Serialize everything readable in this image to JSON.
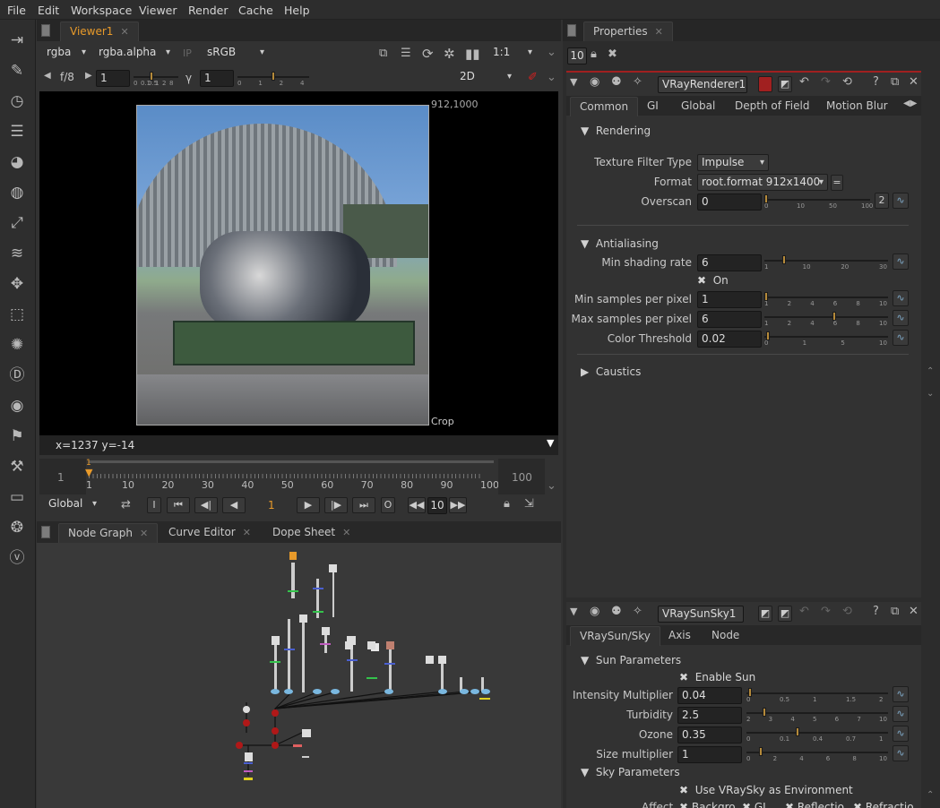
{
  "menu": [
    "File",
    "Edit",
    "Workspace",
    "Viewer",
    "Render",
    "Cache",
    "Help"
  ],
  "toolbar_icons": [
    "hide-panel-icon",
    "paint-icon",
    "clock-icon",
    "channel-icon",
    "color-icon",
    "filter-icon",
    "keyer-icon",
    "merge-icon",
    "transform-icon",
    "3d-icon",
    "particles-icon",
    "deep-icon",
    "views-icon",
    "metadata-icon",
    "toolsets-icon",
    "other-icon",
    "furnace-icon",
    "vray-icon"
  ],
  "viewer": {
    "tab": "Viewer1",
    "channels": "rgba",
    "alpha": "rgba.alpha",
    "ip": "IP",
    "colorspace": "sRGB",
    "zoom": "1:1",
    "fstop": "f/8",
    "gain": "1",
    "gamma_label": "γ",
    "gamma": "1",
    "gain_ticks": [
      "0",
      "0.1",
      "0.5",
      "1",
      "2",
      "8"
    ],
    "gamma_ticks": [
      "0",
      "1",
      "2",
      "4"
    ],
    "view_mode": "2D",
    "res_label": "912,1000",
    "crop_label": "Crop",
    "coords": "x=1237 y=-14",
    "timeline_start": "1",
    "timeline_end": "100",
    "timeline_ticks": [
      "1",
      "10",
      "20",
      "30",
      "40",
      "50",
      "60",
      "70",
      "80",
      "90",
      "100"
    ],
    "current_frame_marker": "1",
    "global": "Global",
    "frame": "1",
    "step": "10",
    "in_btn": "I",
    "out_btn": "O",
    "image_desc": "photo of a jet turbine engine on a green stand in front of a metal hangar"
  },
  "nodegraph": {
    "tabs": [
      "Node Graph",
      "Curve Editor",
      "Dope Sheet"
    ]
  },
  "properties": {
    "tab": "Properties",
    "count": "10",
    "renderer": {
      "name": "VRayRenderer1",
      "tabs": [
        "Common",
        "GI",
        "Global",
        "Depth of Field",
        "Motion Blur"
      ],
      "sections": {
        "rendering": "Rendering",
        "antialiasing": "Antialiasing",
        "caustics": "Caustics"
      },
      "texture_filter_label": "Texture Filter Type",
      "texture_filter": "Impulse",
      "format_label": "Format",
      "format": "root.format 912x1400",
      "format_eq": "=",
      "overscan_label": "Overscan",
      "overscan": "0",
      "overscan_ticks": [
        "0",
        "10",
        "50",
        "100"
      ],
      "overscan_btn": "2",
      "min_shading_label": "Min shading rate",
      "min_shading": "6",
      "min_shading_ticks": [
        "1",
        "10",
        "20",
        "30"
      ],
      "on_label": "On",
      "min_samples_label": "Min samples per pixel",
      "min_samples": "1",
      "max_samples_label": "Max samples per pixel",
      "max_samples": "6",
      "samples_ticks": [
        "1",
        "2",
        "4",
        "6",
        "8",
        "10"
      ],
      "color_threshold_label": "Color Threshold",
      "color_threshold": "0.02",
      "threshold_ticks": [
        "0",
        "1",
        "5",
        "10"
      ]
    },
    "sunsky": {
      "name": "VRaySunSky1",
      "tabs": [
        "VRaySun/Sky",
        "Axis",
        "Node"
      ],
      "sun_section": "Sun Parameters",
      "enable_sun": "Enable Sun",
      "intensity_label": "Intensity Multiplier",
      "intensity": "0.04",
      "intensity_ticks": [
        "0",
        "0.5",
        "1",
        "1.5",
        "2"
      ],
      "turbidity_label": "Turbidity",
      "turbidity": "2.5",
      "turbidity_ticks": [
        "2",
        "3",
        "4",
        "5",
        "6",
        "7",
        "10"
      ],
      "ozone_label": "Ozone",
      "ozone": "0.35",
      "ozone_ticks": [
        "0",
        "0.1",
        "0.4",
        "0.7",
        "1"
      ],
      "size_label": "Size multiplier",
      "size": "1",
      "size_ticks": [
        "0",
        "2",
        "4",
        "6",
        "8",
        "10"
      ],
      "sky_section": "Sky Parameters",
      "use_vraysky": "Use VRaySky as Environment",
      "affect_label": "Affect",
      "affect_opts": [
        "Backgro",
        "GI",
        "Reflectio",
        "Refractio"
      ]
    }
  },
  "colors": {
    "accent_orange": "#e89a2a",
    "render_red": "#a12020",
    "node_red": "#b01818"
  }
}
